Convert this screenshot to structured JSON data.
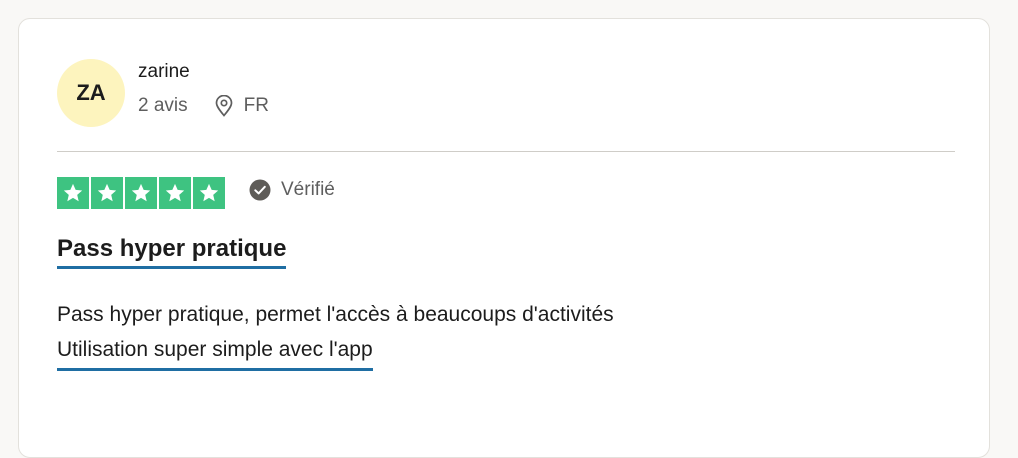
{
  "review": {
    "author": {
      "initials": "ZA",
      "name": "zarine",
      "review_count": "2 avis",
      "country": "FR",
      "avatar_color": "#fdf4be"
    },
    "rating": {
      "stars": 5,
      "max_stars": 5,
      "star_color": "#3ec381",
      "star_icon": "star-icon"
    },
    "verified_label": "Vérifié",
    "verified_icon": "check-circle-icon",
    "location_icon": "map-pin-icon",
    "title": "Pass hyper pratique",
    "body_lines": [
      "Pass hyper pratique, permet l'accès à beaucoups d'activités",
      "Utilisation super simple avec l'app"
    ],
    "link_underline_color": "#1f6ea3"
  }
}
